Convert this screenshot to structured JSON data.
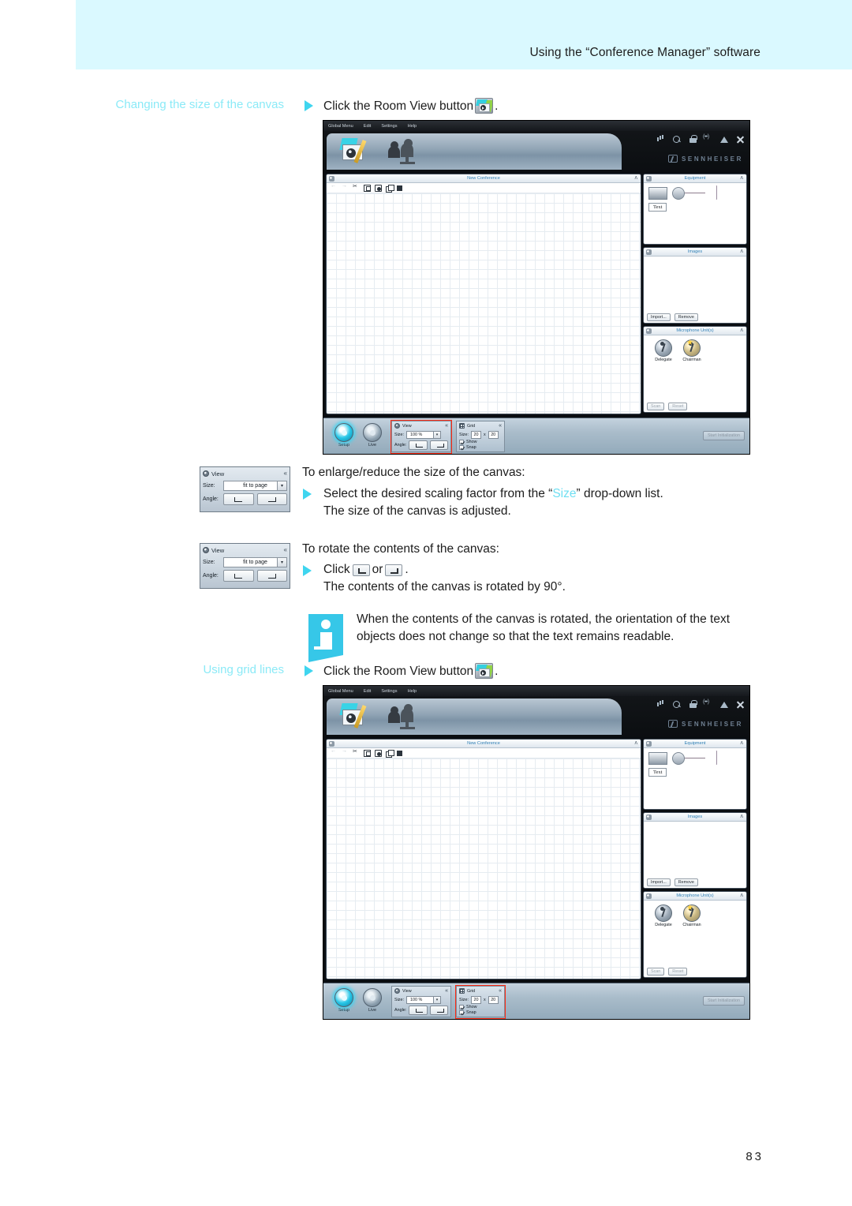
{
  "header": {
    "title": "Using the “Conference Manager” software"
  },
  "page": {
    "number": "83"
  },
  "sections": {
    "canvas_size": {
      "heading": "Changing the size of the canvas",
      "step": "Click the Room View button",
      "step_end": ".",
      "enlarge_intro": "To enlarge/reduce the size of the canvas:",
      "enlarge_step_a": "Select the desired scaling factor from the “",
      "enlarge_step_accent": "Size",
      "enlarge_step_b": "” drop-down list.",
      "enlarge_result": "The size of the canvas is adjusted.",
      "rotate_intro": "To rotate the contents of the canvas:",
      "rotate_step_a": "Click",
      "rotate_step_or": "or",
      "rotate_step_end": ".",
      "rotate_result": "The contents of the canvas is rotated by 90°."
    },
    "note": {
      "line1": "When the contents of the canvas is rotated, the orientation of the text",
      "line2": "objects does not change so that the text remains readable."
    },
    "grid_lines": {
      "heading": "Using grid lines",
      "step": "Click the Room View button",
      "step_end": "."
    }
  },
  "insets": {
    "view_size": {
      "title": "View",
      "collapse": "«",
      "size_label": "Size:",
      "size_value": "fit to page",
      "angle_label": "Angle:"
    },
    "view_rotate": {
      "title": "View",
      "collapse": "«",
      "size_label": "Size:",
      "size_value": "fit to page",
      "angle_label": "Angle:"
    }
  },
  "app": {
    "menu": [
      "Global Menu",
      "Edit",
      "Settings",
      "Help"
    ],
    "brand": "SENNHEISER",
    "window_icons": [
      "volume-icon",
      "zoom-icon",
      "lock-icon",
      "network-icon",
      "warning-icon",
      "close-icon"
    ],
    "canvas_pane": {
      "title": "New Conference",
      "collapse": "ʌ",
      "toolbar_icons": [
        "back-icon",
        "forward-icon",
        "cut-icon",
        "frame-icon",
        "stamp-icon",
        "duplicate-icon",
        "fill-icon"
      ]
    },
    "panels": [
      {
        "title": "Equipment",
        "collapse": "ʌ",
        "text_object": "Text"
      },
      {
        "title": "Images",
        "collapse": "ʌ",
        "buttons": [
          "Import...",
          "Remove"
        ]
      },
      {
        "title": "Microphone Unit(s)",
        "collapse": "ʌ",
        "units": [
          "Delegate",
          "Chairman"
        ],
        "buttons": [
          "Scan",
          "Reset"
        ]
      }
    ],
    "bottom": {
      "modes": [
        "Setup",
        "Live"
      ],
      "view": {
        "title": "View",
        "collapse": "«",
        "size_label": "Size:",
        "size_value": "100 %",
        "angle_label": "Angle:"
      },
      "grid": {
        "title": "Grid",
        "collapse": "«",
        "size_label": "Size:",
        "size_x": "20",
        "size_sep": "x",
        "size_y": "20",
        "show_label": "Show",
        "snap_label": "Snap"
      },
      "start_button": "Start Initialization"
    }
  },
  "colors": {
    "header_band": "#daf9ff",
    "accent_cyan": "#8beaf7",
    "bullet_cyan": "#3fd5ef",
    "highlight_red": "#ff2a13",
    "note_blue": "#36c7e8"
  }
}
